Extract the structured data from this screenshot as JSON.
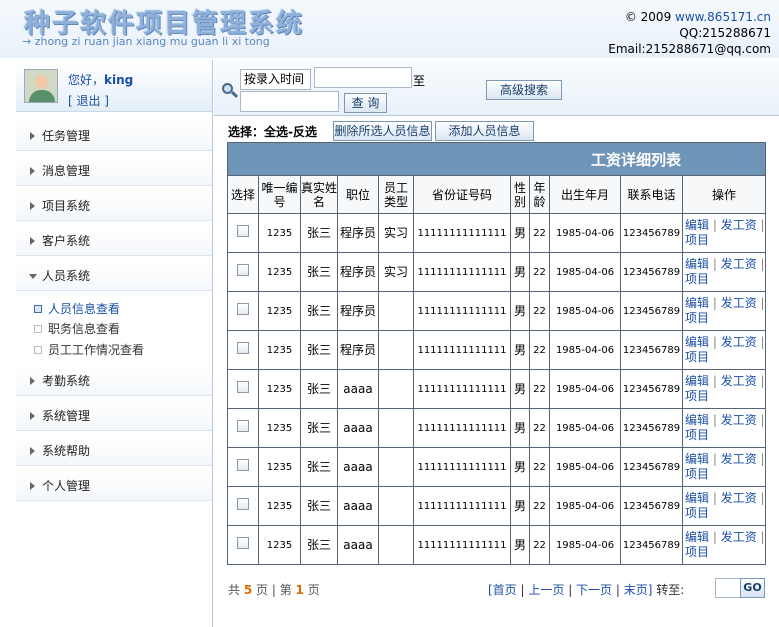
{
  "header": {
    "title": "种子软件项目管理系统",
    "subtitle": "→ zhong zi ruan jian xiang mu guan li xi tong",
    "copyright_prefix": "© 2009 ",
    "website": "www.865171.cn",
    "qq": "QQ:215288671",
    "email": "Email:215288671@qq.com"
  },
  "user": {
    "greeting": "您好，",
    "name": "king",
    "logout": "[ 退出 ]"
  },
  "sidebar": {
    "items": [
      {
        "label": "任务管理"
      },
      {
        "label": "消息管理"
      },
      {
        "label": "项目系统"
      },
      {
        "label": "客户系统"
      },
      {
        "label": "人员系统"
      },
      {
        "label": "考勤系统"
      },
      {
        "label": "系统管理"
      },
      {
        "label": "系统帮助"
      },
      {
        "label": "个人管理"
      }
    ],
    "sub_items": [
      {
        "label": "人员信息查看"
      },
      {
        "label": "职务信息查看"
      },
      {
        "label": "员工工作情况查看"
      }
    ]
  },
  "search": {
    "sort_value": "按录入时间",
    "keyword_value": "",
    "to_label": "至",
    "date_value": "",
    "query_button": "查 询",
    "advanced_button": "高级搜索"
  },
  "toolbar": {
    "select_label": "选择：",
    "select_all_invert": "全选-反选",
    "delete_button": "删除所选人员信息",
    "add_button": "添加人员信息"
  },
  "table": {
    "title": "工资详细列表",
    "headers": [
      "选择",
      "唯一编号",
      "真实姓名",
      "职位",
      "员工类型",
      "省份证号码",
      "性别",
      "年龄",
      "出生年月",
      "联系电话",
      "操作"
    ],
    "edit_label": "编辑",
    "pay_label": "发工资",
    "project_label": "项目",
    "rows": [
      {
        "id": "1235",
        "name": "张三",
        "position": "程序员",
        "type": "实习",
        "idcard": "11111111111111",
        "gender": "男",
        "age": "22",
        "birth": "1985-04-06",
        "phone": "123456789"
      },
      {
        "id": "1235",
        "name": "张三",
        "position": "程序员",
        "type": "实习",
        "idcard": "11111111111111",
        "gender": "男",
        "age": "22",
        "birth": "1985-04-06",
        "phone": "123456789"
      },
      {
        "id": "1235",
        "name": "张三",
        "position": "程序员",
        "type": "",
        "idcard": "11111111111111",
        "gender": "男",
        "age": "22",
        "birth": "1985-04-06",
        "phone": "123456789"
      },
      {
        "id": "1235",
        "name": "张三",
        "position": "程序员",
        "type": "",
        "idcard": "11111111111111",
        "gender": "男",
        "age": "22",
        "birth": "1985-04-06",
        "phone": "123456789"
      },
      {
        "id": "1235",
        "name": "张三",
        "position": "aaaa",
        "type": "",
        "idcard": "11111111111111",
        "gender": "男",
        "age": "22",
        "birth": "1985-04-06",
        "phone": "123456789"
      },
      {
        "id": "1235",
        "name": "张三",
        "position": "aaaa",
        "type": "",
        "idcard": "11111111111111",
        "gender": "男",
        "age": "22",
        "birth": "1985-04-06",
        "phone": "123456789"
      },
      {
        "id": "1235",
        "name": "张三",
        "position": "aaaa",
        "type": "",
        "idcard": "11111111111111",
        "gender": "男",
        "age": "22",
        "birth": "1985-04-06",
        "phone": "123456789"
      },
      {
        "id": "1235",
        "name": "张三",
        "position": "aaaa",
        "type": "",
        "idcard": "11111111111111",
        "gender": "男",
        "age": "22",
        "birth": "1985-04-06",
        "phone": "123456789"
      },
      {
        "id": "1235",
        "name": "张三",
        "position": "aaaa",
        "type": "",
        "idcard": "11111111111111",
        "gender": "男",
        "age": "22",
        "birth": "1985-04-06",
        "phone": "123456789"
      }
    ]
  },
  "pager": {
    "total_prefix": "共 ",
    "total_pages": "5",
    "total_suffix": " 页",
    "divider": " | ",
    "current_prefix": "第 ",
    "current_page": "1",
    "current_suffix": " 页",
    "first": "[首页",
    "prev": "上一页",
    "next": "下一页",
    "last": "末页]",
    "goto_label": "转至:",
    "go_button": "GO"
  },
  "colors": {
    "table_title_bg": "#6e95b8",
    "link": "#1a4fa8",
    "highlight": "#e06b00"
  }
}
